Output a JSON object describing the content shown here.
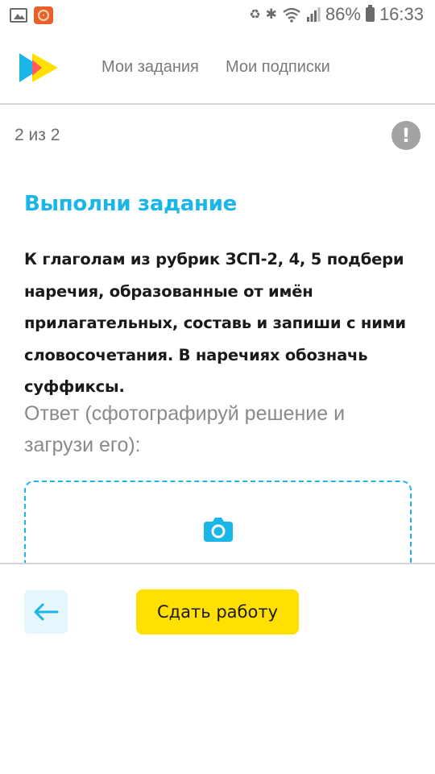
{
  "status_bar": {
    "battery": "86%",
    "time": "16:33",
    "icons": [
      "image-icon",
      "app-notification-icon",
      "battery-saver-icon",
      "bluetooth-icon",
      "wifi-icon",
      "signal-icon",
      "battery-icon"
    ]
  },
  "header": {
    "tabs": [
      {
        "label": "Мои задания"
      },
      {
        "label": "Мои подписки"
      }
    ],
    "colors": {
      "logo_blue": "#1ab6e8",
      "logo_yellow": "#ffe000",
      "logo_red": "#ff5a5f"
    }
  },
  "progress": {
    "counter": "2 из 2",
    "alert_icon": "exclamation-circle-icon"
  },
  "task": {
    "title": "Выполни задание",
    "text": "К глаголам из рубрик ЗСП-2, 4, 5 подбери наречия, образованные от имён прилагательных, составь и запиши с ними словосочетания. В наречиях обозначь суффиксы.",
    "answer_label": "Ответ (сфотографируй решение и загрузи его):"
  },
  "upload": {
    "icon": "camera-icon",
    "accent": "#1ab6e8"
  },
  "footer": {
    "back_icon": "arrow-left-icon",
    "submit_label": "Сдать работу",
    "submit_color": "#ffe000"
  }
}
